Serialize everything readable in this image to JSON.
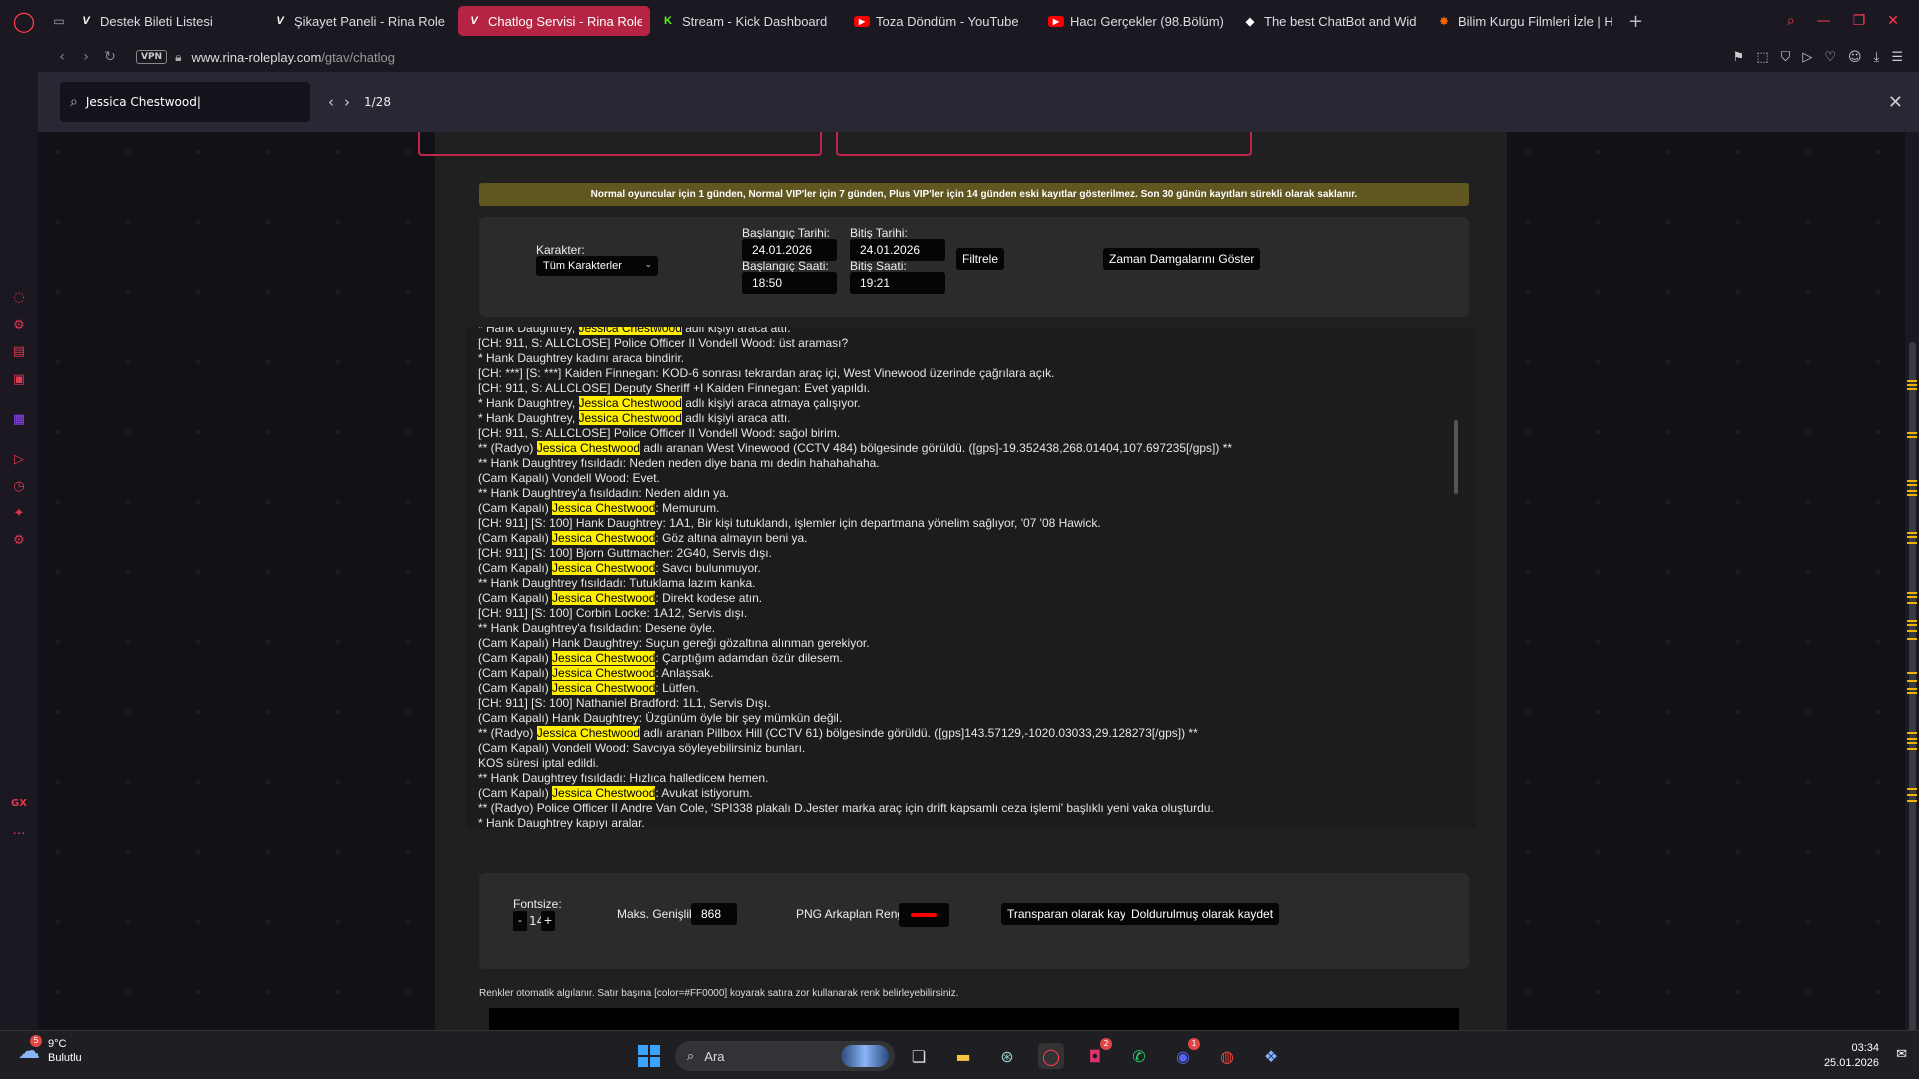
{
  "browser": {
    "tabs": [
      {
        "icon": "ticket-icon",
        "label": "Destek Bileti Listesi",
        "active": false
      },
      {
        "icon": "rina-logo-icon",
        "label": "Şikayet Paneli - Rina Role",
        "active": false
      },
      {
        "icon": "rina-logo-icon",
        "label": "Chatlog Servisi - Rina Role",
        "active": true
      },
      {
        "icon": "kick-logo-icon",
        "label": "Stream - Kick Dashboard",
        "active": false
      },
      {
        "icon": "youtube-icon",
        "label": "Toza Döndüm - YouTube",
        "active": false
      },
      {
        "icon": "youtube-icon",
        "label": "Hacı Gerçekler (98.Bölüm)",
        "active": false
      },
      {
        "icon": "chatbot-icon",
        "label": "The best ChatBot and Wid",
        "active": false
      },
      {
        "icon": "film-icon",
        "label": "Bilim Kurgu Filmleri İzle | H",
        "active": false
      }
    ],
    "vpn_label": "VPN",
    "url_host": "www.rina-roleplay.com",
    "url_path": "/gtav/chatlog"
  },
  "find": {
    "query": "Jessica Chestwood",
    "count": "1/28"
  },
  "notice": "Normal oyuncular için 1 günden, Normal VIP'ler için 7 günden, Plus VIP'ler için 14 günden eski kayıtlar gösterilmez. Son 30 günün kayıtları sürekli olarak saklanır.",
  "filters": {
    "character_label": "Karakter:",
    "character_value": "Tüm Karakterler",
    "start_date_label": "Başlangıç Tarihi:",
    "start_date": "24.01.2026",
    "end_date_label": "Bitiş Tarihi:",
    "end_date": "24.01.2026",
    "start_time_label": "Başlangıç Saati:",
    "start_time": "18:50",
    "end_time_label": "Bitiş Saati:",
    "end_time": "19:21",
    "filter_button": "Filtrele",
    "timestamps_button": "Zaman Damgalarını Göster"
  },
  "highlight": "Jessica Chestwood",
  "log_lines": [
    "* Hank Daughtrey, Jessica Chestwood adlı kişiyi araca attı.",
    "[CH: 911, S: ALLCLOSE] Police Officer II Vondell Wood: üst araması?",
    "* Hank Daughtrey kadını araca bindirir.",
    "[CH: ***] [S: ***] Kaiden Finnegan: KOD-6 sonrası tekrardan araç içi, West Vinewood üzerinde çağrılara açık.",
    "[CH: 911, S: ALLCLOSE] Deputy Sheriff +I Kaiden Finnegan: Evet yapıldı.",
    "* Hank Daughtrey, Jessica Chestwood adlı kişiyi araca atmaya çalışıyor.",
    "* Hank Daughtrey, Jessica Chestwood adlı kişiyi araca attı.",
    "[CH: 911, S: ALLCLOSE] Police Officer II Vondell Wood: sağol birim.",
    "** (Radyo) Jessica Chestwood adlı aranan West Vinewood (CCTV 484) bölgesinde görüldü. ([gps]-19.352438,268.01404,107.697235[/gps]) **",
    "** Hank Daughtrey fısıldadı: Neden neden diye bana mı dedin hahahahaha.",
    "(Cam Kapalı) Vondell Wood: Evet.",
    "** Hank Daughtrey'a fısıldadın: Neden aldın ya.",
    "(Cam Kapalı) Jessica Chestwood: Memurum.",
    "[CH: 911] [S: 100] Hank Daughtrey: 1A1, Bir kişi tutuklandı, işlemler için departmana yönelim sağlıyor, '07 '08 Hawick.",
    "(Cam Kapalı) Jessica Chestwood: Göz altına almayın beni ya.",
    "[CH: 911] [S: 100] Bjorn Guttmacher: 2G40, Servis dışı.",
    "(Cam Kapalı) Jessica Chestwood: Savcı bulunmuyor.",
    "** Hank Daughtrey fısıldadı: Tutuklama lazım kanka.",
    "(Cam Kapalı) Jessica Chestwood: Direkt kodese atın.",
    "[CH: 911] [S: 100] Corbin Locke: 1A12, Servis dışı.",
    "** Hank Daughtrey'a fısıldadın: Desene öyle.",
    "(Cam Kapalı) Hank Daughtrey: Suçun gereği gözaltına alınman gerekiyor.",
    "(Cam Kapalı) Jessica Chestwood: Çarptığım adamdan özür dilesem.",
    "(Cam Kapalı) Jessica Chestwood: Anlaşsak.",
    "(Cam Kapalı) Jessica Chestwood: Lütfen.",
    "[CH: 911] [S: 100] Nathaniel Bradford: 1L1, Servis Dışı.",
    "(Cam Kapalı) Hank Daughtrey: Üzgünüm öyle bir şey mümkün değil.",
    "** (Radyo) Jessica Chestwood adlı aranan Pillbox Hill (CCTV 61) bölgesinde görüldü. ([gps]143.57129,-1020.03033,29.128273[/gps]) **",
    "(Cam Kapalı) Vondell Wood: Savcıya söyleyebilirsiniz bunları.",
    "KOS süresi iptal edildi.",
    "** Hank Daughtrey fısıldadı: Hızlıca hallediceм hemen.",
    "(Cam Kapalı) Jessica Chestwood: Avukat istiyorum.",
    "** (Radyo) Police Officer II Andre Van Cole, 'SPI338 plakalı D.Jester marka araç için drift kapsamlı ceza işlemi' başlıklı yeni vaka oluşturdu.",
    "* Hank Daughtrey kapıyı aralar."
  ],
  "export": {
    "fontsize_label": "Fontsize:",
    "fontsize_minus": "-",
    "fontsize_value": "14",
    "fontsize_plus": "+",
    "max_width_label": "Maks. Genişlik:",
    "max_width_value": "868",
    "png_bg_label": "PNG Arkaplan Rengi:",
    "png_bg_color": "#ff0000",
    "save_transparent": "Transparan olarak kaydet",
    "save_filled": "Doldurulmuş olarak kaydet"
  },
  "hint": "Renkler otomatik algılanır. Satır başına [color=#FF0000] koyarak satıra zor kullanarak renk belirleyebilirsiniz.",
  "taskbar": {
    "weather_badge": "5",
    "temperature": "9°C",
    "weather_desc": "Bulutlu",
    "search_placeholder": "Ara",
    "instagram_badge": "2",
    "discord_badge": "1",
    "time": "03:34",
    "date": "25.01.2026"
  }
}
